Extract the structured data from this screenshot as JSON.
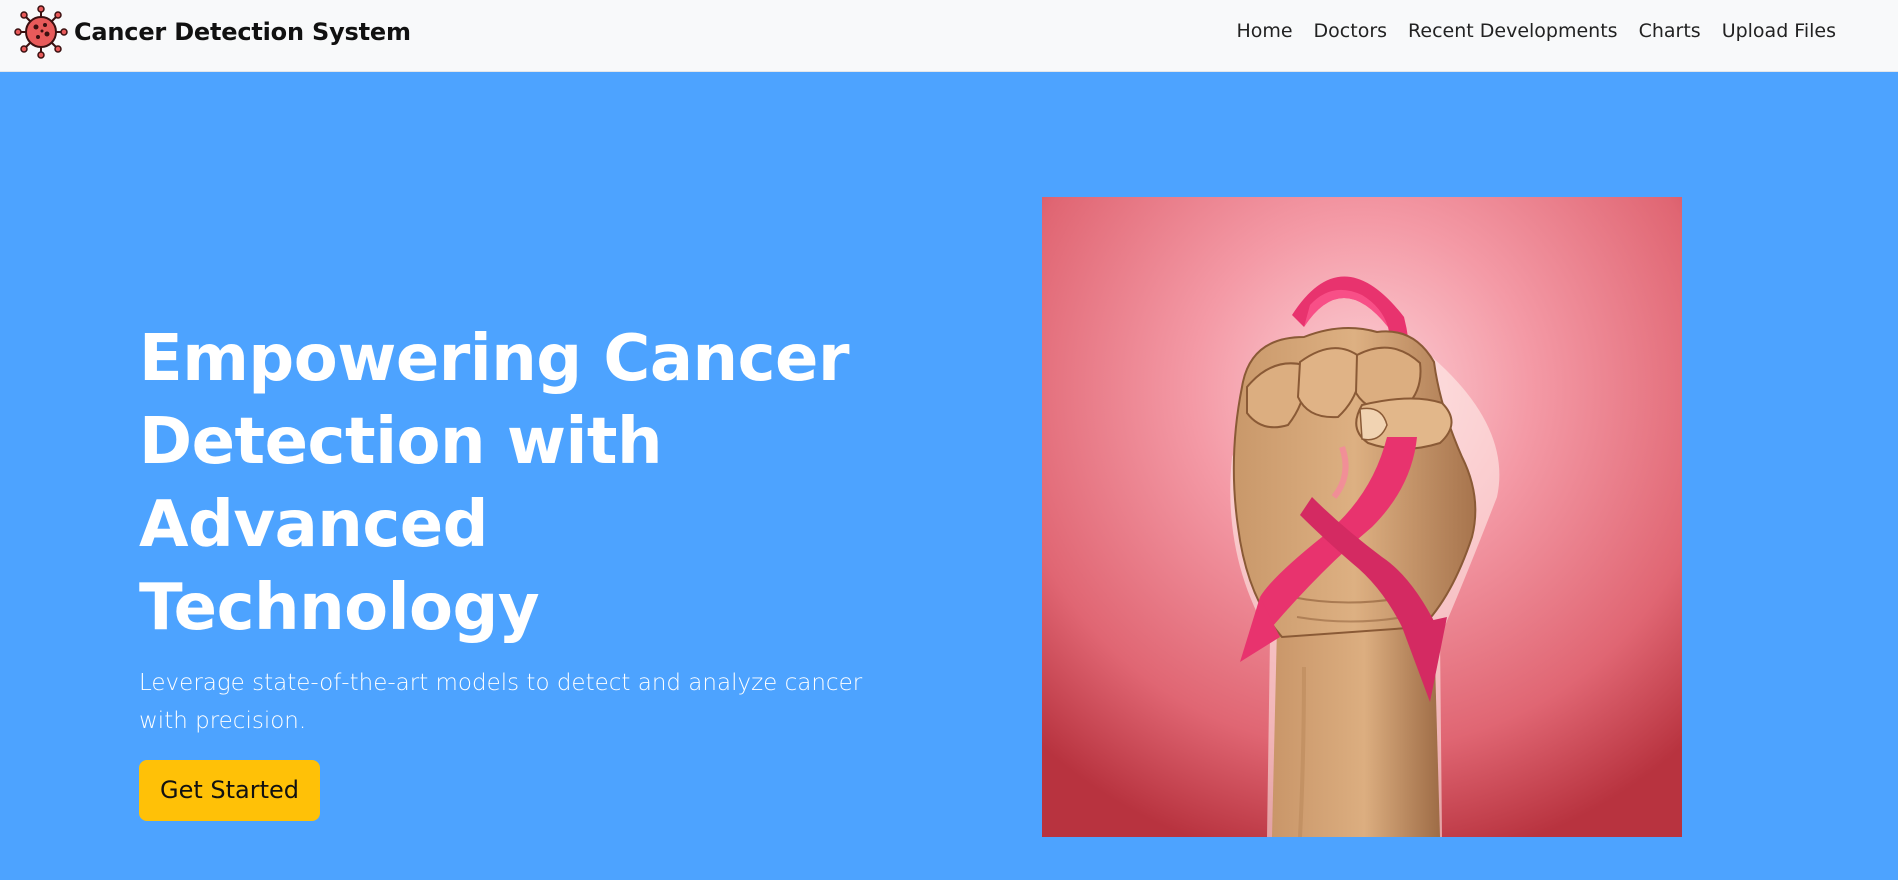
{
  "navbar": {
    "brand_icon": "virus-cell-icon",
    "brand_text": "Cancer Detection System",
    "links": [
      "Home",
      "Doctors",
      "Recent Developments",
      "Charts",
      "Upload Files"
    ]
  },
  "hero": {
    "title": "Empowering Cancer Detection with Advanced Technology",
    "subtitle": "Leverage state-of-the-art models to detect and analyze cancer with precision.",
    "cta_label": "Get Started",
    "image_icon": "fist-holding-pink-ribbon-image"
  },
  "colors": {
    "hero_background": "#4da3ff",
    "navbar_background": "#f8f9fa",
    "cta_background": "#ffc107",
    "ribbon": "#e8336e"
  }
}
